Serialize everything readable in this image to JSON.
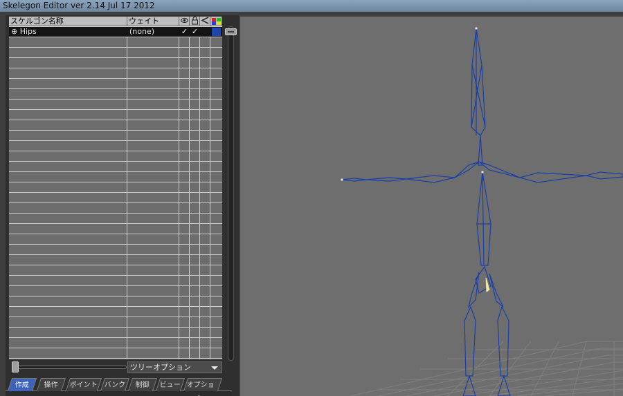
{
  "window": {
    "title": "Skelegon Editor ver 2.14 Jul 17 2012"
  },
  "table": {
    "headers": {
      "name": "スケルゴン名称",
      "weight": "ウェイト",
      "visible_icon": "eye-icon",
      "lock_icon": "lock-icon",
      "draw_icon": "bone-icon",
      "color_icon": "color-swatch-icon"
    },
    "rows": [
      {
        "name": "⊕ Hips",
        "weight": "(none)",
        "visible": "✓",
        "locked": "✓",
        "color": "#1f45a9"
      }
    ]
  },
  "tree_options": {
    "label": "ツリーオプション"
  },
  "tabs": [
    {
      "label": "作成",
      "active": true
    },
    {
      "label": "操作",
      "active": false
    },
    {
      "label": "ポイント",
      "active": false
    },
    {
      "label": "バンク",
      "active": false
    },
    {
      "label": "制御",
      "active": false
    },
    {
      "label": "ビュー",
      "active": false
    },
    {
      "label": "オプション",
      "active": false
    }
  ],
  "colors": {
    "skeleton": "#1a3ea8",
    "viewport_bg": "#6e6e6e",
    "active_tab": "#3d62b8"
  }
}
